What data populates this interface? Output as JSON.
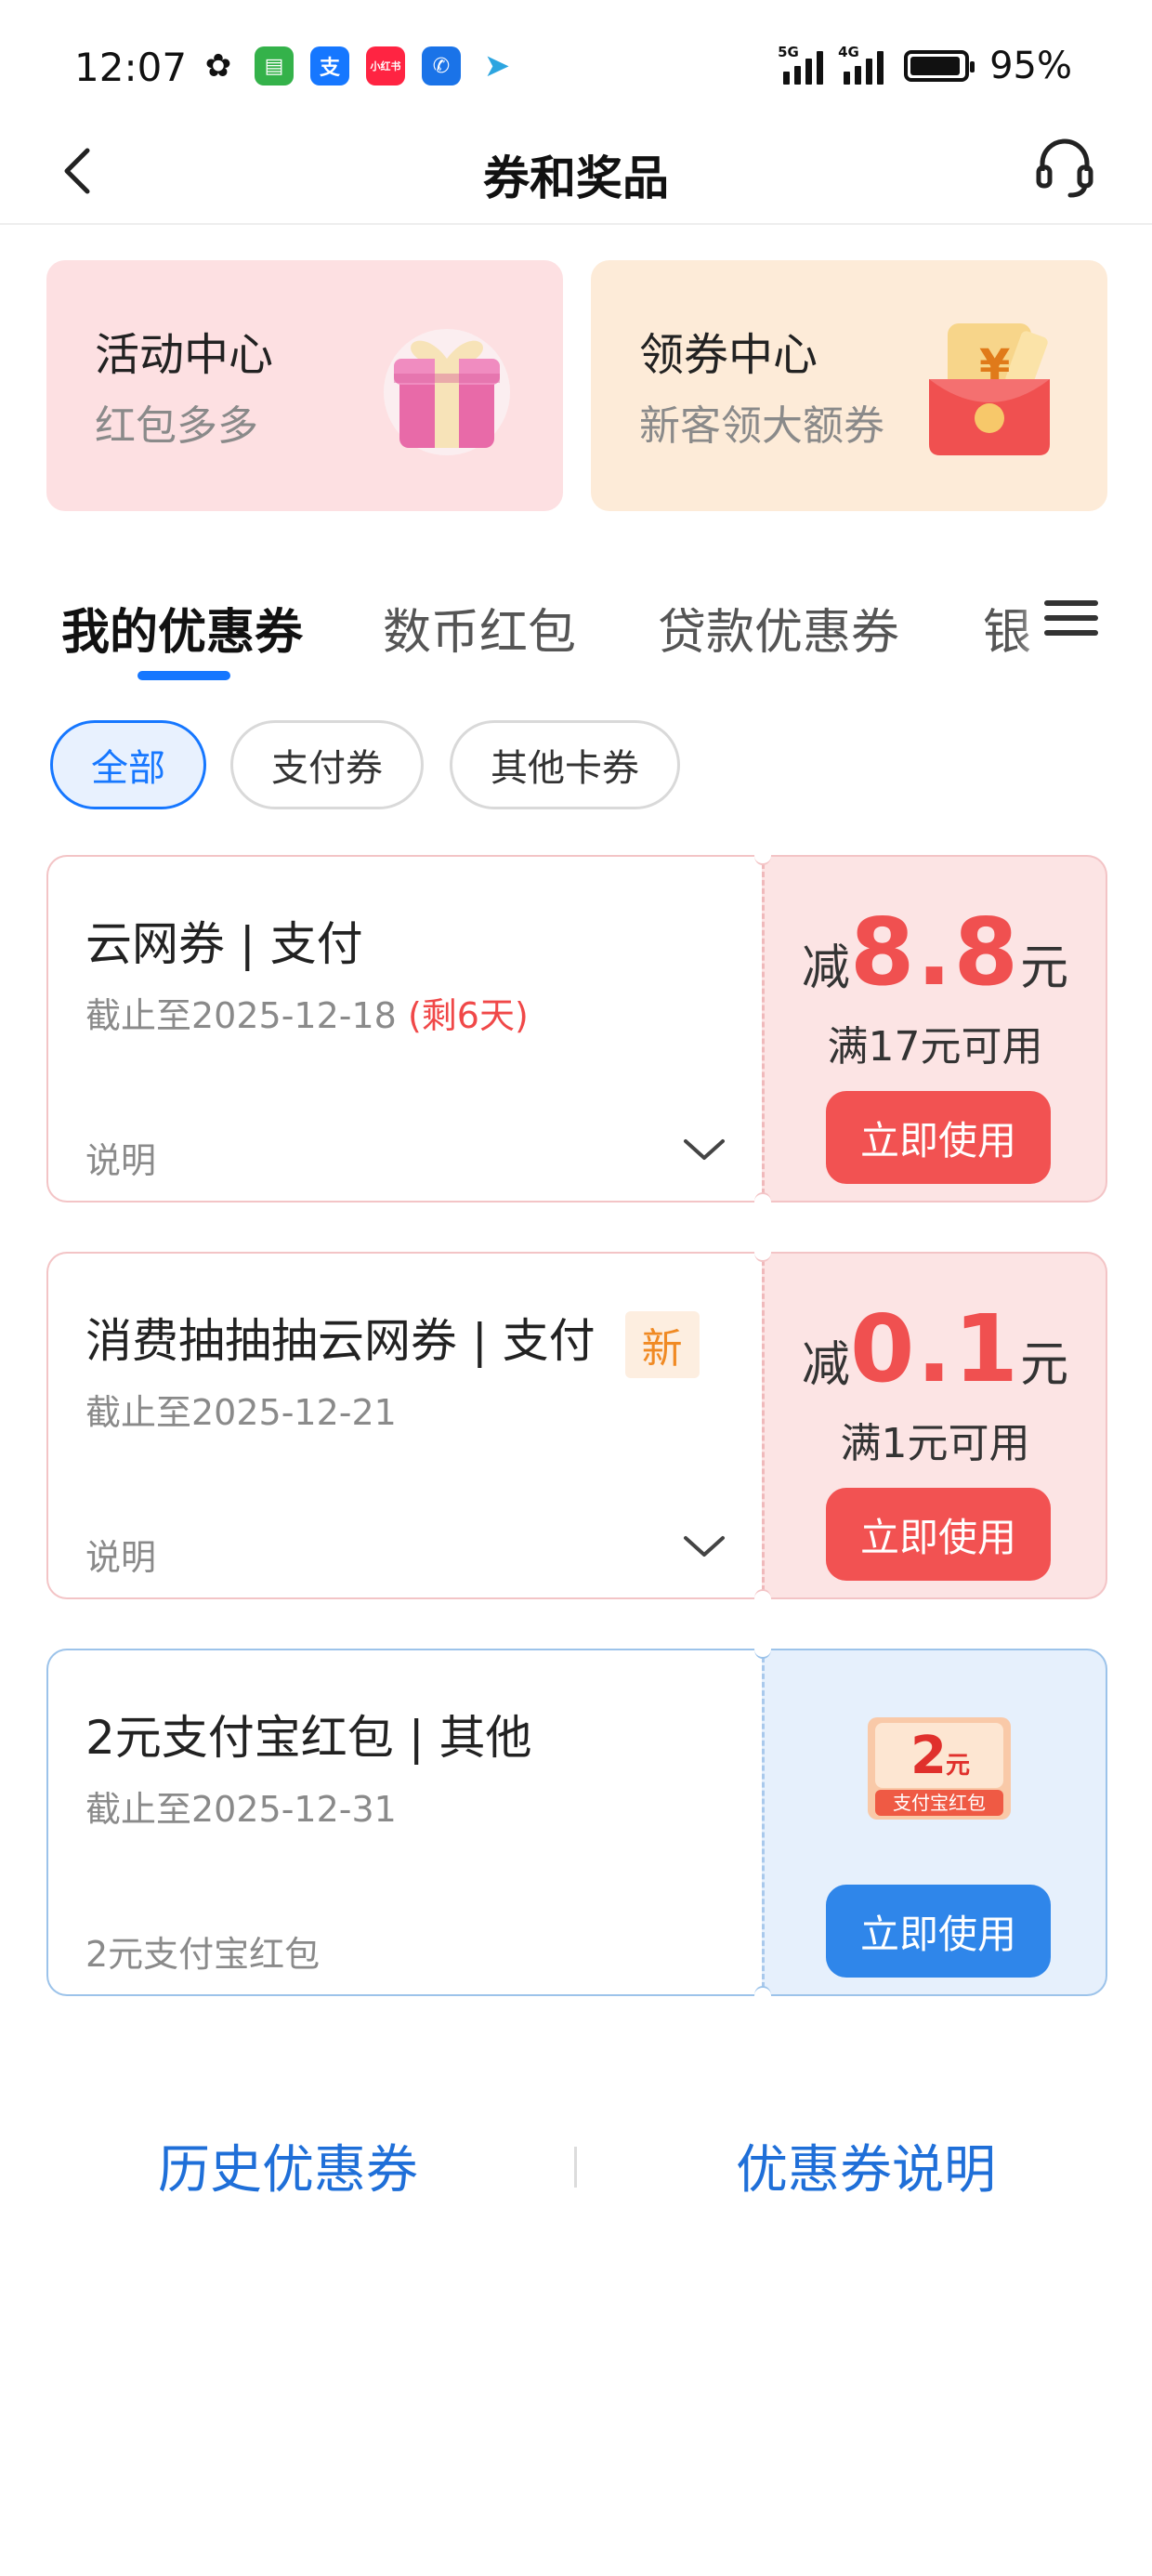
{
  "status_bar": {
    "time": "12:07",
    "apps": [
      {
        "icon": "wechat-icon",
        "color": "#111111",
        "glyph": "✿"
      },
      {
        "icon": "messages-icon",
        "color": "#34b24a",
        "glyph": "▤"
      },
      {
        "icon": "alipay-icon",
        "color": "#1677ff",
        "glyph": "支"
      },
      {
        "icon": "xiaohongshu-icon",
        "color": "#ff2442",
        "glyph": "小红书"
      },
      {
        "icon": "phone-icon",
        "color": "#1a73e8",
        "glyph": "✆"
      },
      {
        "icon": "telegram-icon",
        "color": "#2ca5e0",
        "glyph": "➤"
      }
    ],
    "network_1": "5G",
    "network_2": "4G",
    "battery_percent": "95%",
    "battery_level": 0.95
  },
  "nav": {
    "title": "券和奖品",
    "back_icon": "chevron-left-icon",
    "service_icon": "headset-icon"
  },
  "banners": [
    {
      "title": "活动中心",
      "subtitle": "红包多多",
      "icon": "gift-box-icon",
      "bg": "#fde0e2"
    },
    {
      "title": "领券中心",
      "subtitle": "新客领大额券",
      "icon": "red-envelope-icon",
      "bg": "#fdebd8"
    }
  ],
  "tabs": [
    "我的优惠券",
    "数币红包",
    "贷款优惠券",
    "银"
  ],
  "active_tab": "我的优惠券",
  "filters": [
    "全部",
    "支付券",
    "其他卡券"
  ],
  "active_filter": "全部",
  "coupons": [
    {
      "title": "云网券 | 支付",
      "expiry": "截止至2025-12-18",
      "remaining": "(剩6天)",
      "desc": "说明",
      "amount_prefix": "减",
      "amount": "8.8",
      "amount_unit": "元",
      "condition": "满17元可用",
      "button": "立即使用"
    },
    {
      "title": "消费抽抽抽云网券 | 支付",
      "badge": "新",
      "expiry": "截止至2025-12-21",
      "desc": "说明",
      "amount_prefix": "减",
      "amount": "0.1",
      "amount_unit": "元",
      "condition": "满1元可用",
      "button": "立即使用"
    },
    {
      "title": "2元支付宝红包 | 其他",
      "expiry": "截止至2025-12-31",
      "desc": "2元支付宝红包",
      "image_amount": "2",
      "image_unit": "元",
      "image_label": "支付宝红包",
      "button": "立即使用"
    }
  ],
  "footer": {
    "history": "历史优惠券",
    "explain": "优惠券说明"
  },
  "colors": {
    "accent_blue": "#1677ff",
    "coupon_red": "#f05050",
    "button_red": "#f25252",
    "button_blue": "#2f86ea"
  }
}
